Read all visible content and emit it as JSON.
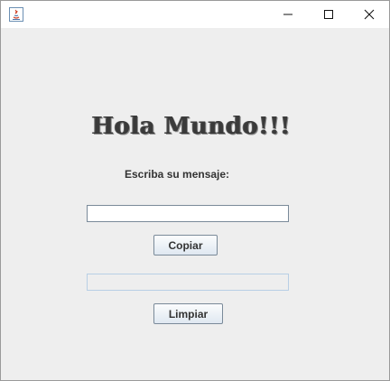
{
  "window": {
    "title": "",
    "icon": "java-icon",
    "controls": [
      "minimize-icon",
      "maximize-icon",
      "close-icon"
    ]
  },
  "main": {
    "heading": "Hola Mundo!!!",
    "prompt_label": "Escriba su mensaje:",
    "input_value": "",
    "copy_button_label": "Copiar",
    "output_value": "",
    "clear_button_label": "Limpiar"
  }
}
